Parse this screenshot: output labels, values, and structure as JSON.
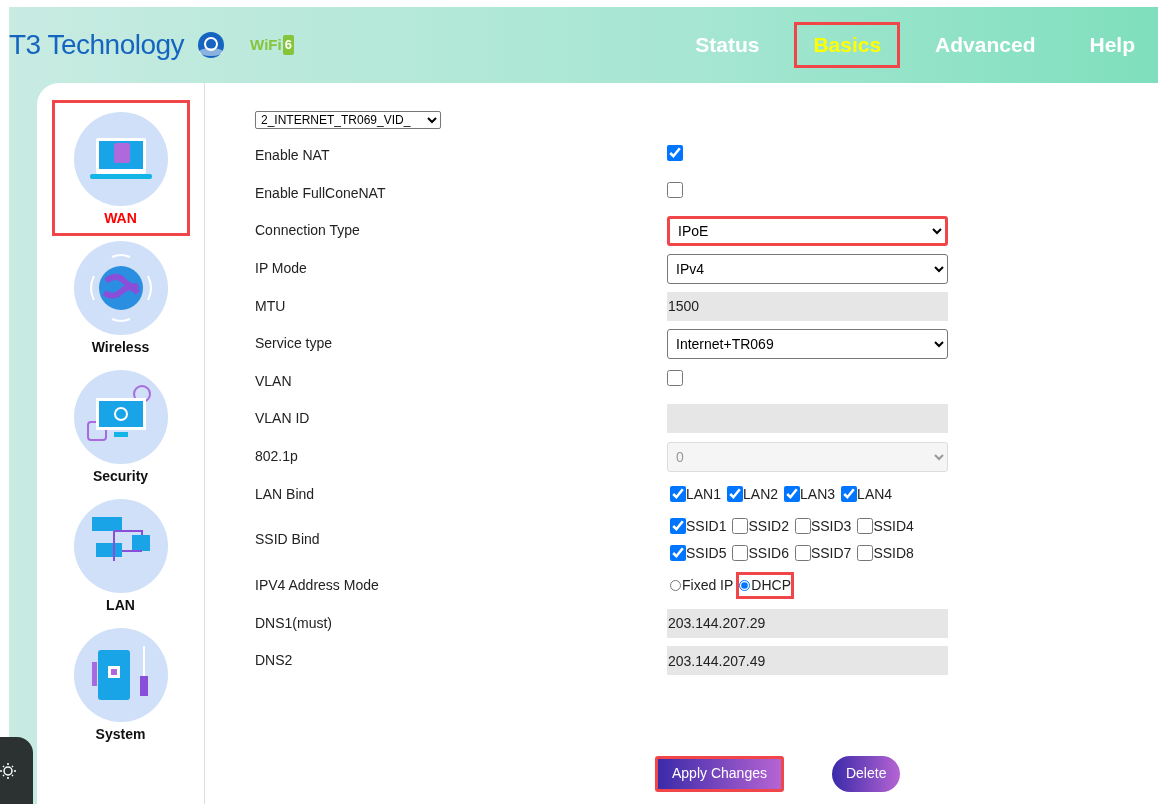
{
  "header": {
    "brand": "T3 Technology",
    "wifi_text": "WiFi",
    "wifi_badge": "6"
  },
  "nav": [
    {
      "label": "Status",
      "selected": false,
      "highlighted": false
    },
    {
      "label": "Basics",
      "selected": true,
      "highlighted": true
    },
    {
      "label": "Advanced",
      "selected": false,
      "highlighted": false
    },
    {
      "label": "Help",
      "selected": false,
      "highlighted": false
    }
  ],
  "sidebar": [
    {
      "label": "WAN",
      "selected": true,
      "highlighted": true
    },
    {
      "label": "Wireless",
      "selected": false,
      "highlighted": false
    },
    {
      "label": "Security",
      "selected": false,
      "highlighted": false
    },
    {
      "label": "LAN",
      "selected": false,
      "highlighted": false
    },
    {
      "label": "System",
      "selected": false,
      "highlighted": false
    }
  ],
  "connection_select": {
    "value": "2_INTERNET_TR069_VID_"
  },
  "fields": [
    {
      "label": "Enable NAT",
      "kind": "checkbox",
      "checked": true
    },
    {
      "label": "Enable FullConeNAT",
      "kind": "checkbox",
      "checked": false
    },
    {
      "label": "Connection Type",
      "kind": "select",
      "value": "IPoE",
      "disabled": false,
      "highlighted": true
    },
    {
      "label": "IP Mode",
      "kind": "select",
      "value": "IPv4",
      "disabled": false,
      "highlighted": false
    },
    {
      "label": "MTU",
      "kind": "text",
      "value": "1500",
      "disabled": true
    },
    {
      "label": "Service type",
      "kind": "select",
      "value": "Internet+TR069",
      "disabled": false,
      "highlighted": false
    },
    {
      "label": "VLAN",
      "kind": "checkbox",
      "checked": false
    },
    {
      "label": "VLAN ID",
      "kind": "text",
      "disabled": true
    },
    {
      "label": "802.1p",
      "kind": "select",
      "value": "0",
      "disabled": true,
      "highlighted": false
    },
    {
      "label": "LAN Bind",
      "kind": "checks",
      "lines": [
        [
          {
            "label": "LAN1",
            "checked": true
          },
          {
            "label": "LAN2",
            "checked": true
          },
          {
            "label": "LAN3",
            "checked": true
          },
          {
            "label": "LAN4",
            "checked": true
          }
        ]
      ]
    },
    {
      "label": "SSID Bind",
      "kind": "checks",
      "lines": [
        [
          {
            "label": "SSID1",
            "checked": true
          },
          {
            "label": "SSID2",
            "checked": false
          },
          {
            "label": "SSID3",
            "checked": false
          },
          {
            "label": "SSID4",
            "checked": false
          }
        ],
        [
          {
            "label": "SSID5",
            "checked": true
          },
          {
            "label": "SSID6",
            "checked": false
          },
          {
            "label": "SSID7",
            "checked": false
          },
          {
            "label": "SSID8",
            "checked": false
          }
        ]
      ]
    },
    {
      "label": "IPV4 Address Mode",
      "kind": "radio",
      "options": [
        {
          "label": "Fixed IP",
          "selected": false,
          "highlighted": false
        },
        {
          "label": "DHCP",
          "selected": true,
          "highlighted": true
        }
      ]
    },
    {
      "label": "DNS1(must)",
      "kind": "text",
      "value": "203.144.207.29",
      "disabled": true
    },
    {
      "label": "DNS2",
      "kind": "text",
      "value": "203.144.207.49",
      "disabled": true
    }
  ],
  "buttons": [
    {
      "label": "Apply Changes",
      "highlighted": true
    },
    {
      "label": "Delete",
      "highlighted": false
    }
  ]
}
